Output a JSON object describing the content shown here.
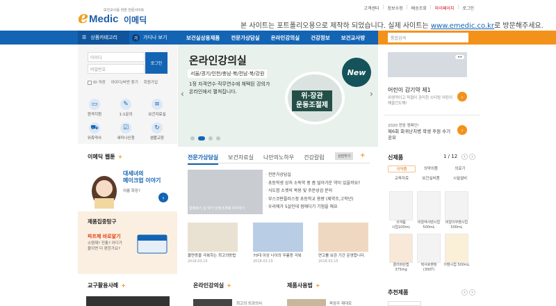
{
  "top_links": [
    "고객센터",
    "정보수정",
    "배송조회",
    "마이페이지",
    "로그인"
  ],
  "logo": {
    "tagline": "보건교사를 위한 전문사이트",
    "e": "e",
    "medic": "Medic",
    "korean": "이메딕"
  },
  "notice": {
    "prefix": "본 사이트는 포트폴리오용으로 제작하 되었습니다. 실제 사이트는 ",
    "url": "www.emedic.co.kr",
    "suffix": "로 방문해주세요."
  },
  "nav": {
    "category_button": "상품카테고리",
    "indicator_letter": "가",
    "indicator_label": "가디나 보기",
    "menu": [
      "보건실상용제품",
      "전문가상담실",
      "온라인강의실",
      "건강정보",
      "보건교사방"
    ],
    "search_placeholder": "통합검색"
  },
  "login": {
    "id_placeholder": "아이디",
    "pw_placeholder": "비밀번호",
    "button": "로그인",
    "save_id": "ID 저장",
    "find": "아이디/비번 찾기",
    "join": "회원가입"
  },
  "quick_menu": [
    {
      "icon": "monitor-icon",
      "glyph": "▭",
      "label": "원격지원"
    },
    {
      "icon": "pencil-icon",
      "glyph": "✎",
      "label": "1:1문의"
    },
    {
      "icon": "layers-icon",
      "glyph": "≡",
      "label": "보건자료실"
    },
    {
      "icon": "truck-icon",
      "glyph": "⛟",
      "label": "위촉약사"
    },
    {
      "icon": "checkbox-icon",
      "glyph": "☑",
      "label": "세미나신청"
    },
    {
      "icon": "refresh-icon",
      "glyph": "↻",
      "label": "샘플교환"
    }
  ],
  "webtoon": {
    "title": "이메딕 웹툰",
    "headline1": "대세녀의",
    "headline2": "메이크업 이야기",
    "sub": "여름 화장?"
  },
  "focus": {
    "title": "제품집중탐구",
    "headline": "파프제 바로알기",
    "desc1": "소염제? 진통? 어디가",
    "desc2": "붙이면 더 편한가요?"
  },
  "banner": {
    "title": "온라인강의실",
    "regions": "서울/경기/인천/충남·북/전남·북/강원",
    "desc1": "1정 자격연수·직무연수에 체택된 강의가",
    "desc2": "온라인에서 펼쳐집니다.",
    "badge": "New",
    "topic1": "위·장관",
    "topic2": "운동조절제"
  },
  "center_tabs": [
    "전문가상담실",
    "보건자료실",
    "나만의노하우",
    "건강칼럼"
  ],
  "center_more": "상담하기",
  "featured_caption": "알레르기 성 약가 인테 5개제 치우하기",
  "articles": [
    "전문가상담실",
    "초등학생 상처 소독약 중 좀 덜아가운 약이 있을까요?",
    "식도염 소켓의 복용 및 주문성검 문의",
    "부스코판플러스정 초등학교 용량 (제약조,고학년)",
    "우리에가 5살인데 점애디기 기험을 해요"
  ],
  "thumbs": [
    {
      "title": "물면증을 극복하는 최고의방법",
      "date": "2018.03.15"
    },
    {
      "title": "70대 이상 나이의 무릎증 극복",
      "date": "2018.03.15"
    },
    {
      "title": "연고를 보관 기간 운영합니다.",
      "date": "2018.03.15"
    }
  ],
  "right": {
    "banner_pager": "◂ ▸",
    "mag_title": "어린이 감기약 제1",
    "mag_desc1": "위생적이고 적절이 관리한 스티링 어린이",
    "mag_desc2": "해결건도해!",
    "event_sub": "2020 연중 캠페인!",
    "event_title": "제6회 회귀난치병 학생 후원 수기 공모",
    "new_products_title": "신제품",
    "page": "1 / 12",
    "categories": [
      "의약품",
      "의약외품",
      "의료기",
      "교육자료",
      "보건실비품",
      "시설설비"
    ],
    "products": [
      {
        "name1": "의약품",
        "name2": "시럽100mL"
      },
      {
        "name1": "비알덱사텐시럽",
        "name2": "500mL"
      },
      {
        "name1": "비알이부펜시럽",
        "name2": "500mL"
      },
      {
        "name1": "클리바린캡",
        "name2": "375mg"
      },
      {
        "name1": "텍사로펜정",
        "name2": "(300T)"
      },
      {
        "name1": "이펜시럽 500mL",
        "name2": ""
      }
    ],
    "recommend_title": "추천제품"
  },
  "bottom": {
    "sec1": "교구활용사례",
    "sec2": "온라인강의실",
    "sec3": "제품사용법",
    "sec2_sub": "최고의 외과의사",
    "sec3_sub": "파암주 제대로"
  }
}
